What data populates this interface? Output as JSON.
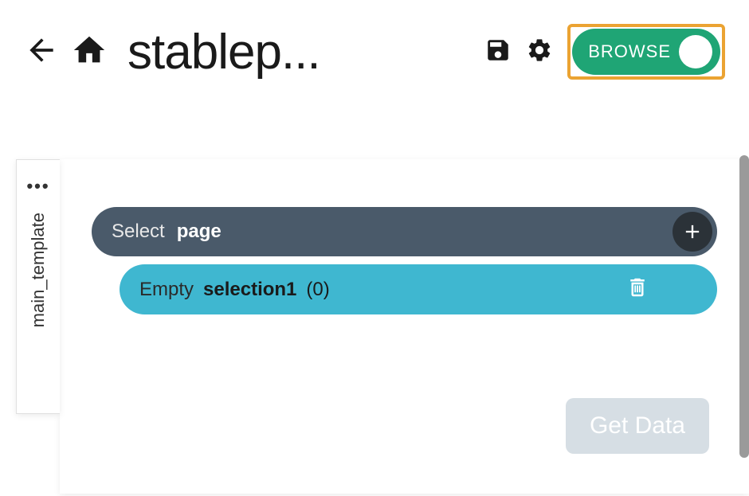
{
  "header": {
    "title": "stablep...",
    "toggle_label": "BROWSE"
  },
  "sidebar": {
    "tab_dots": "•••",
    "tab_label": "main_template"
  },
  "selector": {
    "label": "Select",
    "target": "page"
  },
  "selection": {
    "status": "Empty",
    "name": "selection1",
    "count": "(0)"
  },
  "actions": {
    "get_data": "Get Data"
  }
}
